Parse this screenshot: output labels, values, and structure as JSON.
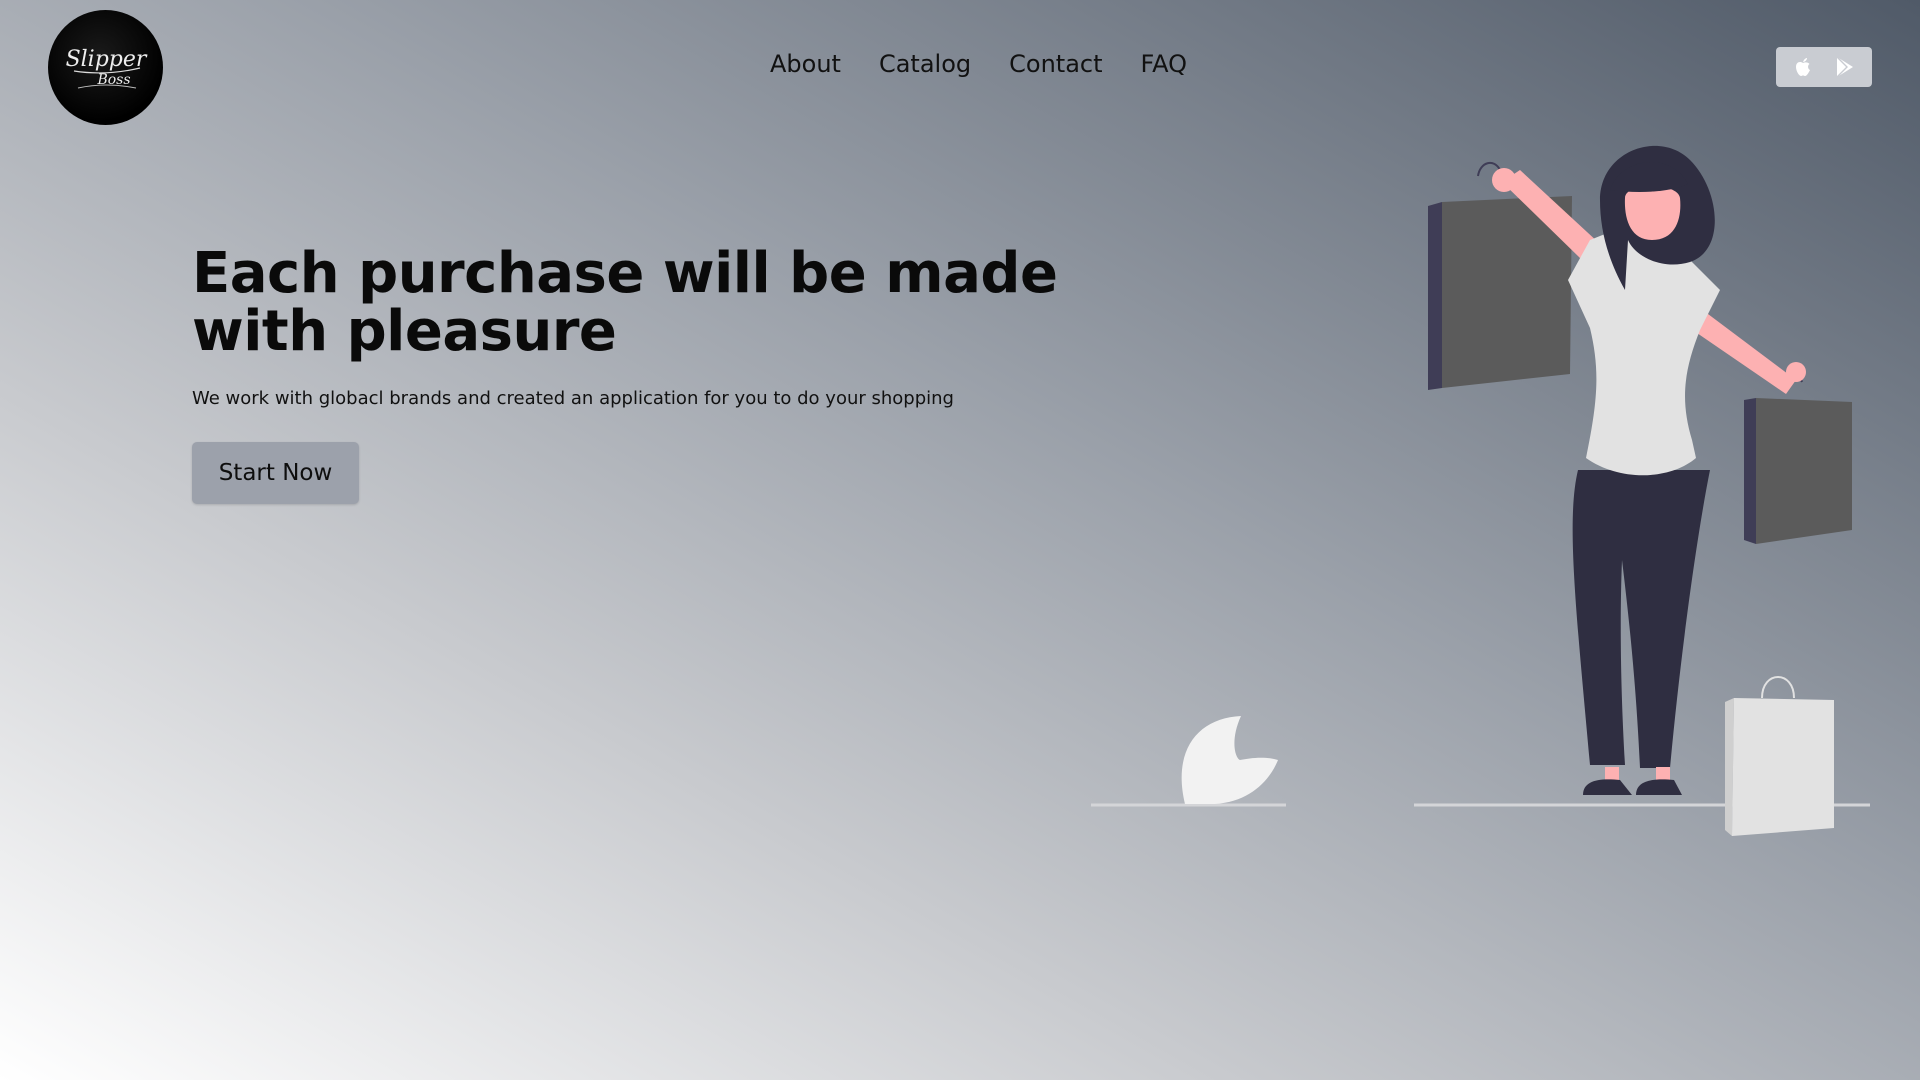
{
  "brand": {
    "logo_text": "Slipper Boss"
  },
  "nav": {
    "items": [
      {
        "label": "About"
      },
      {
        "label": "Catalog"
      },
      {
        "label": "Contact"
      },
      {
        "label": "FAQ"
      }
    ]
  },
  "stores": [
    {
      "icon": "apple-icon"
    },
    {
      "icon": "google-play-icon"
    }
  ],
  "hero": {
    "title": "Each purchase will be made with pleasure",
    "subtitle": "We work with globacl brands and created an application for you to do your shopping",
    "cta_label": "Start Now"
  },
  "colors": {
    "button_bg": "#9ca1ab",
    "store_box_bg": "#c9ccd2",
    "logo_bg": "#000000",
    "skin": "#fdb1b2",
    "pants": "#2f2e41",
    "bag_dark": "#5b5b5b",
    "bag_light": "#e2e2e2"
  }
}
